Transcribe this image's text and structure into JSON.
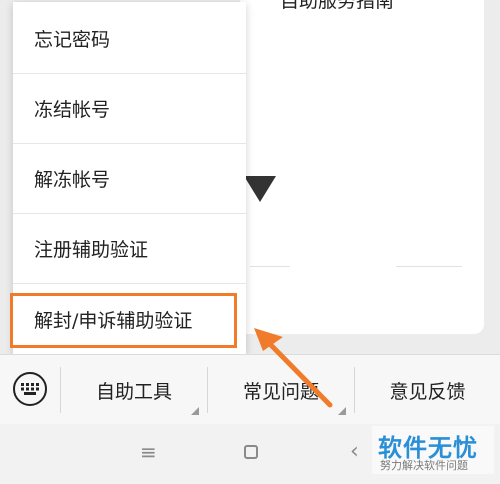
{
  "background": {
    "cut_off_text": "自助服务指南"
  },
  "menu": {
    "items": [
      {
        "label": "忘记密码"
      },
      {
        "label": "冻结帐号"
      },
      {
        "label": "解冻帐号"
      },
      {
        "label": "注册辅助验证"
      },
      {
        "label": "解封/申诉辅助验证"
      }
    ]
  },
  "toolbar": {
    "keyboard_icon": "keyboard-icon",
    "tabs": [
      {
        "label": "自助工具"
      },
      {
        "label": "常见问题"
      },
      {
        "label": "意见反馈"
      }
    ]
  },
  "navbar": {
    "menu_icon": "menu-icon",
    "home_icon": "home-square-icon",
    "back_icon": "back-chevron-icon"
  },
  "watermark": {
    "title": "软件无忧",
    "subtitle": "努力解决软件问题"
  },
  "colors": {
    "highlight": "#f07c2b",
    "watermark_blue": "#2a8fd6"
  }
}
